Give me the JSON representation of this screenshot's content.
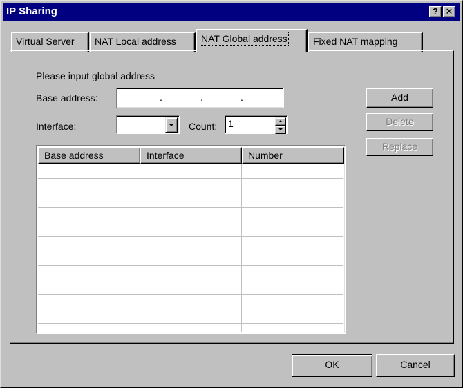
{
  "window": {
    "title": "IP Sharing",
    "help_glyph": "?",
    "close_glyph": "✕"
  },
  "tabs": [
    {
      "label": "Virtual Server",
      "active": false
    },
    {
      "label": "NAT Local address",
      "active": false
    },
    {
      "label": "NAT Global address",
      "active": true
    },
    {
      "label": "Fixed NAT mapping",
      "active": false
    }
  ],
  "form": {
    "prompt": "Please input global address",
    "base_address_label": "Base address:",
    "base_address_value": "",
    "base_address_separator": ".",
    "interface_label": "Interface:",
    "interface_value": "",
    "count_label": "Count:",
    "count_value": "1"
  },
  "side_buttons": {
    "add": "Add",
    "delete": "Delete",
    "replace": "Replace"
  },
  "table": {
    "columns": [
      "Base address",
      "Interface",
      "Number"
    ],
    "rows": []
  },
  "footer": {
    "ok": "OK",
    "cancel": "Cancel"
  },
  "colors": {
    "title_bar": "#000080",
    "face": "#c0c0c0",
    "disabled_text": "#808080"
  }
}
